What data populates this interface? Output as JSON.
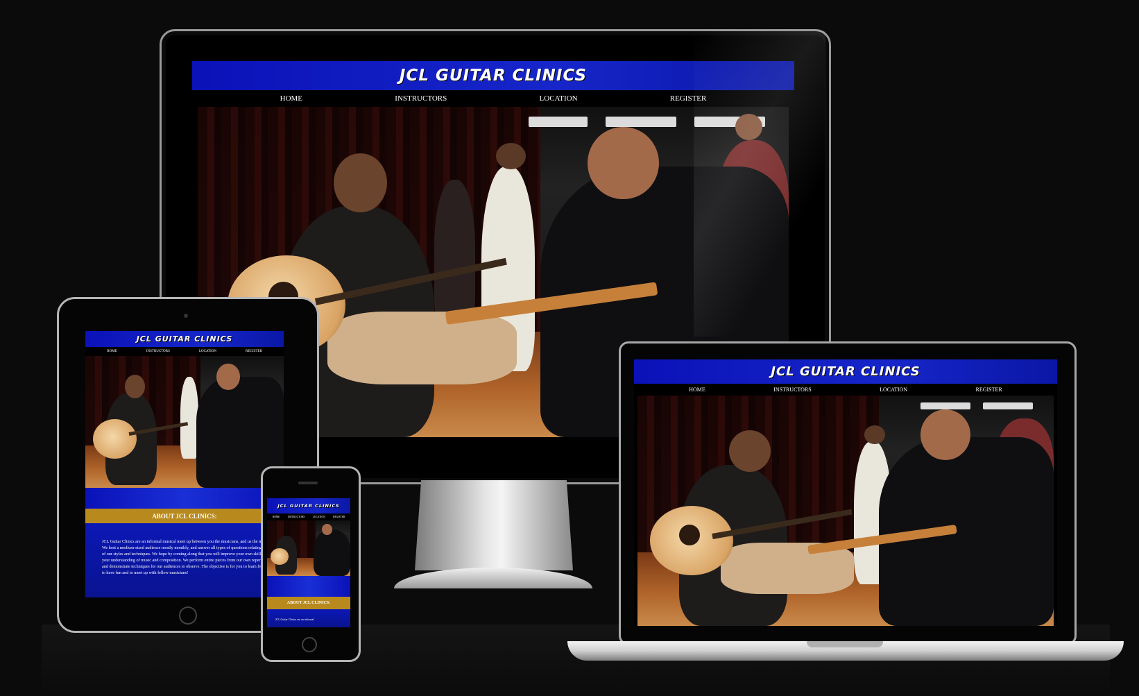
{
  "site": {
    "title": "JCL GUITAR CLINICS",
    "nav": [
      "HOME",
      "INSTRUCTORS",
      "LOCATION",
      "REGISTER"
    ],
    "about_heading": "ABOUT JCL CLINICS:",
    "about_text": "JCL Guitar Clinics are an informal musical meet up between you the musicians, and us the instructors. We host a medium-sized audience mostly monthly, and answer all types of questions relating to each of our styles and techniques. We hope by coming along that you will improve your own skill sets and your understanding of music and composition. We perform entire pieces from our own repertoires, and demonstrate techniques for our audiences to observe. The objective is for you to learn from us and to have fun and to meet up with fellow musicians!",
    "about_text_phone": "JCL Guitar Clinics are an informal"
  },
  "colors": {
    "page_background": "#0b0b0b",
    "header_blue": "#1626c9",
    "about_gold": "#b88a1e"
  },
  "hero_image": "guitar-lesson-photo"
}
